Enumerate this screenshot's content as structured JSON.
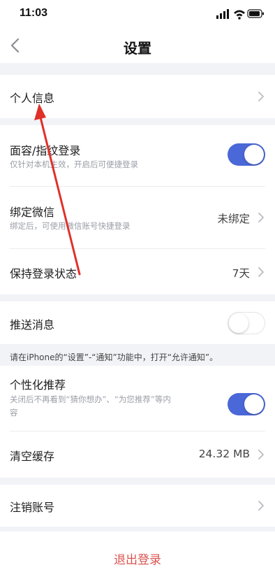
{
  "status_bar": {
    "time": "11:03"
  },
  "nav": {
    "title": "设置"
  },
  "personal_info": {
    "label": "个人信息"
  },
  "face_login": {
    "label": "面容/指纹登录",
    "subtitle": "仅针对本机生效，开启后可便捷登录",
    "enabled": true
  },
  "bind_wechat": {
    "label": "绑定微信",
    "subtitle": "绑定后，可使用微信账号快捷登录",
    "value": "未绑定"
  },
  "keep_login": {
    "label": "保持登录状态",
    "value": "7天"
  },
  "push": {
    "label": "推送消息",
    "enabled": false,
    "notice": "请在iPhone的“设置”-“通知”功能中，打开“允许通知”。"
  },
  "recommend": {
    "label": "个性化推荐",
    "subtitle_line1": "关闭后不再看到“猜你想办”、“为您推荐”等内",
    "subtitle_line2": "容",
    "enabled": true
  },
  "cache": {
    "label": "清空缓存",
    "value": "24.32 MB"
  },
  "cancel_account": {
    "label": "注销账号"
  },
  "logout": {
    "label": "退出登录"
  },
  "colors": {
    "toggle_on": "#4a68d7",
    "logout_text": "#d9534f",
    "annotation_arrow": "#e0302a",
    "background": "#f1f3f7"
  },
  "icons": [
    "back-icon",
    "signal-icon",
    "wifi-icon",
    "battery-icon",
    "chevron-right-icon"
  ]
}
